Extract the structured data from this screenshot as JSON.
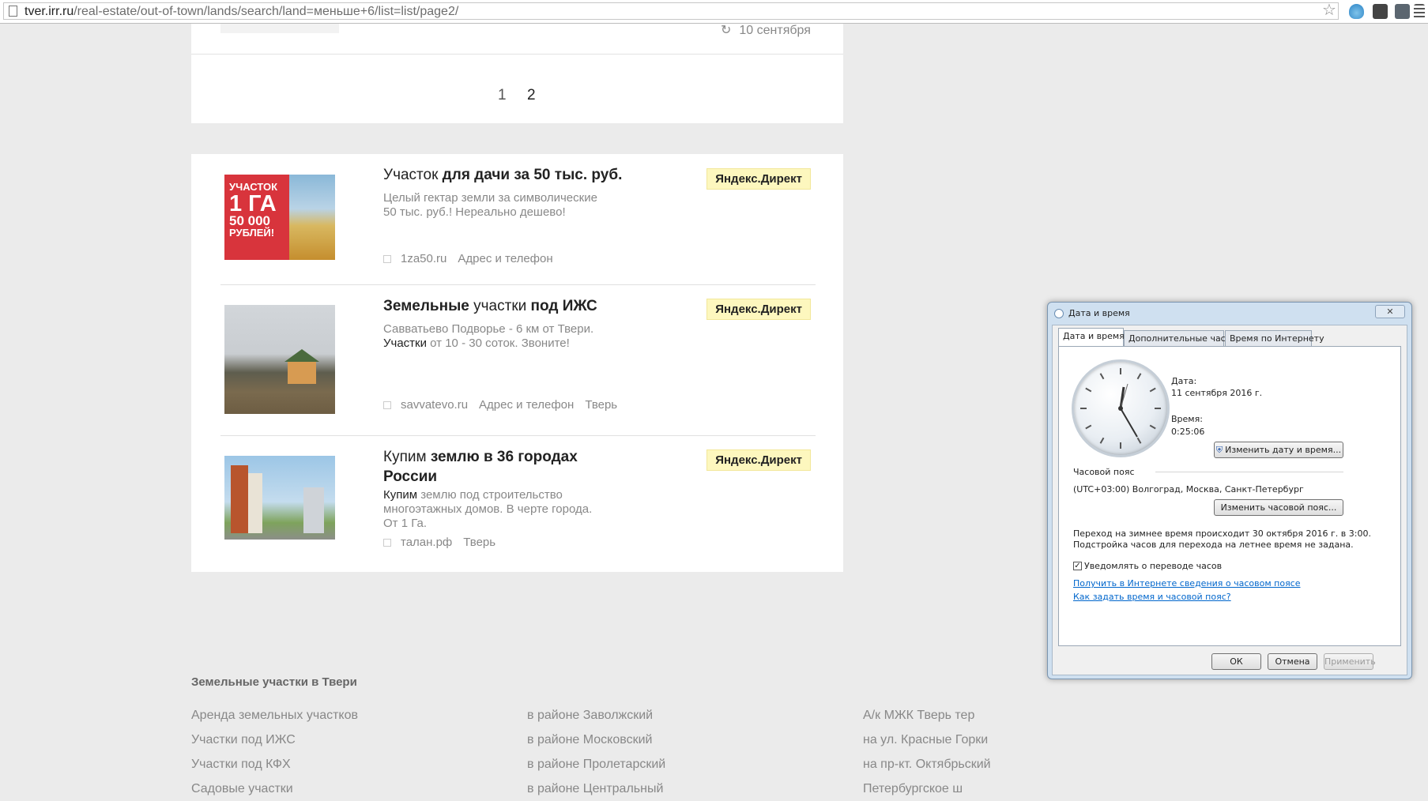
{
  "browser": {
    "url_domain": "tver.irr.ru",
    "url_path": "/real-estate/out-of-town/lands/search/land=меньше+6/list=list/page2/"
  },
  "top_item": {
    "date": "10 сентября"
  },
  "pagination": {
    "pages": [
      "1",
      "2"
    ],
    "current": "2"
  },
  "ads": [
    {
      "image_text": [
        "УЧАСТОК",
        "1 ГА",
        "50 000",
        "РУБЛЕЙ!"
      ],
      "title_lite": "Участок",
      "title_bold": " для дачи за 50 тыс. руб.",
      "desc_line1": "Целый гектар земли за символические",
      "desc_line2": "50 тыс. руб.! Нереально дешево!",
      "domain": "1za50.ru",
      "contacts": "Адрес и телефон",
      "city": "",
      "badge": "Яндекс.Директ"
    },
    {
      "title_a": "Земельные",
      "title_lite": " участки ",
      "title_b": "под ИЖС",
      "desc_line1": "Савватьево Подворье - 6 км от Твери.",
      "desc_bold": "Участки",
      "desc_line2": " от 10 - 30 соток. Звоните!",
      "domain": "savvatevo.ru",
      "contacts": "Адрес и телефон",
      "city": "Тверь",
      "badge": "Яндекс.Директ"
    },
    {
      "title_lite": "Купим",
      "title_bold": " землю в 36 городах России",
      "desc_bold": "Купим",
      "desc_line1": " землю под строительство",
      "desc_line2": "многоэтажных домов. В черте города.",
      "desc_line3": "От 1 Га.",
      "domain": "талан.рф",
      "city": "Тверь",
      "badge": "Яндекс.Директ"
    }
  ],
  "footer": {
    "title": "Земельные участки в Твери",
    "col1": [
      "Аренда земельных участков",
      "Участки под ИЖС",
      "Участки под КФХ",
      "Садовые участки"
    ],
    "col2": [
      "в районе Заволжский",
      "в районе Московский",
      "в районе Пролетарский",
      "в районе Центральный"
    ],
    "col3": [
      "А/к МЖК Тверь тер",
      "на ул. Красные Горки",
      "на пр-кт. Октябрьский",
      "Петербургское ш"
    ]
  },
  "dialog": {
    "title": "Дата и время",
    "tabs": [
      "Дата и время",
      "Дополнительные часы",
      "Время по Интернету"
    ],
    "date_label": "Дата:",
    "date_value": "11 сентября 2016 г.",
    "time_label": "Время:",
    "time_value": "0:25:06",
    "change_datetime_button": "Изменить дату и время...",
    "timezone_label": "Часовой пояс",
    "timezone_value": "(UTC+03:00) Волгоград, Москва, Санкт-Петербург",
    "change_timezone_button": "Изменить часовой пояс...",
    "dst_line1": "Переход на зимнее время происходит 30 октября 2016 г. в 3:00.",
    "dst_line2": "Подстройка часов для перехода на летнее время не задана.",
    "notify_checkbox": "Уведомлять о переводе часов",
    "link1": "Получить в Интернете сведения о часовом поясе",
    "link2": "Как задать время и часовой пояс?",
    "ok": "ОК",
    "cancel": "Отмена",
    "apply": "Применить"
  }
}
